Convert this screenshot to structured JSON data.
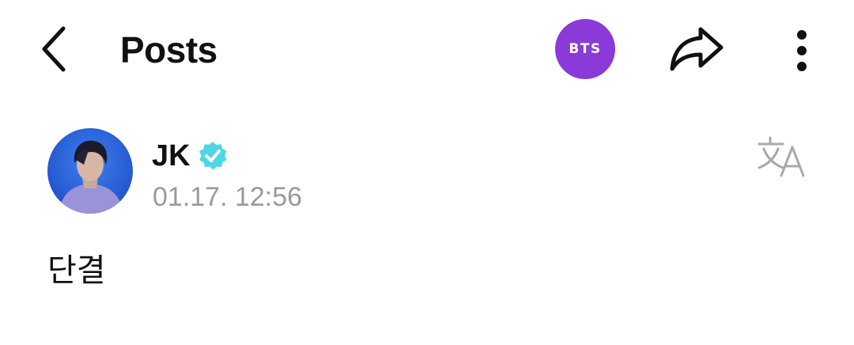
{
  "header": {
    "title": "Posts",
    "community_badge": "BTS",
    "back_icon": "chevron-left-icon",
    "share_icon": "share-arrow-icon",
    "more_icon": "vertical-dots-icon",
    "badge_color": "#8a3ad8"
  },
  "post": {
    "author": "JK",
    "verified_icon": "verified-badge-icon",
    "verified_color": "#4fd6e4",
    "timestamp": "01.17. 12:56",
    "translate_icon": "translate-icon",
    "body": "단결"
  }
}
